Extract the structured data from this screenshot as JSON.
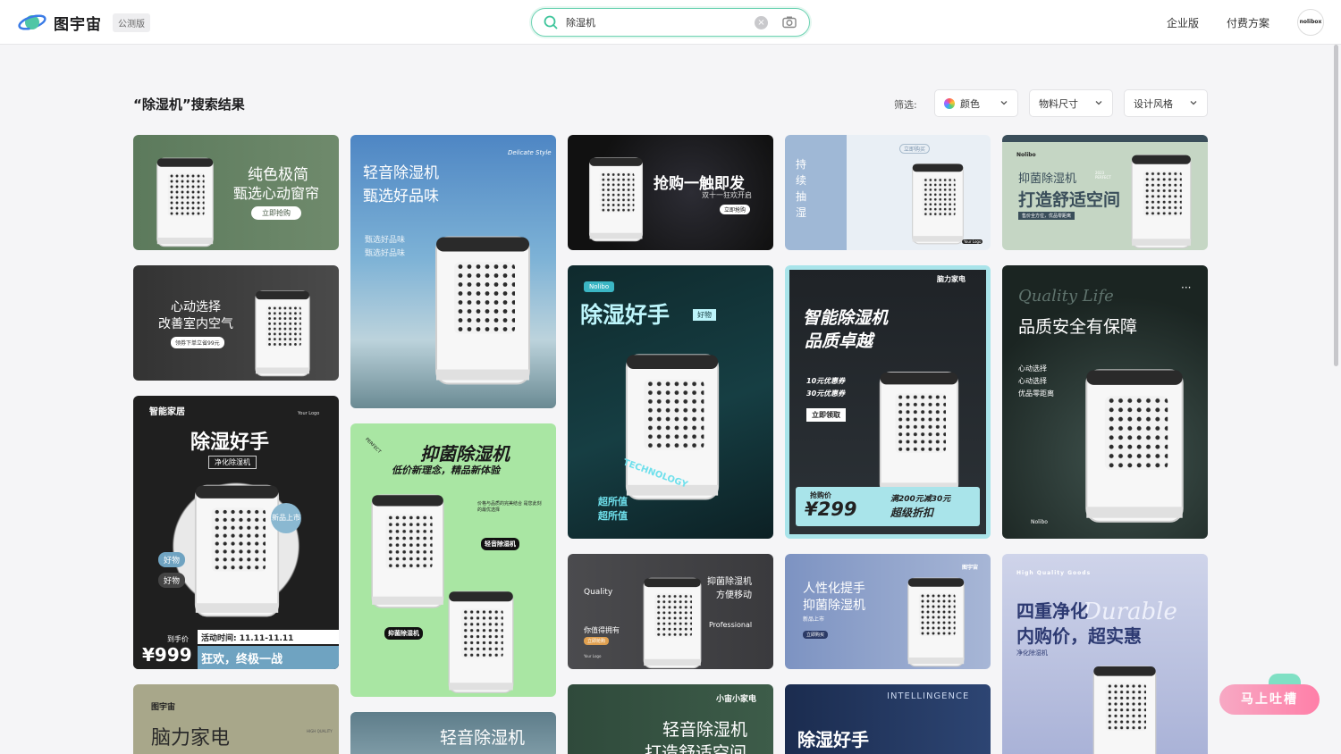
{
  "header": {
    "brand": "图宇宙",
    "beta_badge": "公测版",
    "search": {
      "value": "除湿机",
      "placeholder": ""
    },
    "nav": {
      "enterprise": "企业版",
      "pricing": "付费方案"
    },
    "avatar_text": "nolibox"
  },
  "results": {
    "title": "“除湿机”搜索结果",
    "filter_label": "筛选:",
    "filters": [
      "颜色",
      "物料尺寸",
      "设计风格"
    ]
  },
  "cards": {
    "c1": {
      "title": "纯色极简",
      "subtitle": "甄选心动窗帘",
      "cta": "立即抢购"
    },
    "c2": {
      "title": "心动选择",
      "subtitle": "改善室内空气",
      "cta": "领券下单立省99元"
    },
    "c3": {
      "tag": "智能家居",
      "logo": "Your Logo",
      "title": "除湿好手",
      "subtitle": "净化除湿机",
      "badge_new": "新品上市",
      "pill1": "好物",
      "pill2": "好物",
      "price_label": "到手价",
      "price": "¥999",
      "event": "活动时间: 11.11-11.11",
      "slogan": "狂欢，终极一战"
    },
    "c4": {
      "title": "脑力家电",
      "brand": "图宇宙",
      "side": "HIGH QUALITY"
    },
    "c5": {
      "script": "Delicate Style",
      "title": "轻音除湿机",
      "subtitle": "甄选好品味",
      "desc1": "甄选好品味",
      "desc2": "甄选好品味"
    },
    "c6": {
      "title": "抑菌除湿机",
      "subtitle": "低价新理念，精品新体验",
      "desc": "价格与品质的完美结合 是您此刻的最优选择",
      "tag1": "轻音除湿机",
      "tag2": "抑菌除湿机",
      "stamp": "PERFECT"
    },
    "c7": {
      "title": "轻音除湿机"
    },
    "c8": {
      "title": "抢购一触即发",
      "subtitle": "双十一狂欢开启",
      "cta": "立即抢购"
    },
    "c9": {
      "brand": "Nolibo",
      "title": "除湿好手",
      "badge": "好物",
      "line1": "超所值",
      "line2": "超所值",
      "ribbon": "TECHNOLOGY"
    },
    "c10": {
      "title1": "抑菌除湿机",
      "title2": "方便移动",
      "quality": "Quality",
      "professional": "Professional",
      "desc": "你值得拥有",
      "tag": "立即抢购",
      "logo": "Your Logo"
    },
    "c11": {
      "shop": "小宙小家电",
      "title": "轻音除湿机",
      "subtitle": "打造舒适空间"
    },
    "c12": {
      "side_text": "持续抽湿",
      "side_small": "智能除湿机",
      "cta": "立即购买",
      "logo": "Your Logo"
    },
    "c13": {
      "shop": "脑力家电",
      "title": "智能除湿机",
      "subtitle": "品质卓越",
      "coupon1": "10元优惠券",
      "coupon2": "30元优惠券",
      "cta": "立即领取",
      "price_label": "抢购价",
      "price": "¥299",
      "deal": "满200元减30元",
      "deal2": "超级折扣"
    },
    "c14": {
      "title": "人性化提手",
      "subtitle": "抑菌除湿机",
      "small": "新品上市",
      "cta": "立即购买",
      "brand": "图宇宙"
    },
    "c15": {
      "title": "除湿好手",
      "script": "INTELLINGENCE"
    },
    "c16": {
      "brand": "Nolibo",
      "title": "抑菌除湿机",
      "subtitle": "打造舒适空间",
      "tag": "售价全方位，优品零距离",
      "year": "2023 PERFECT"
    },
    "c17": {
      "script": "Quality Life",
      "title": "品质安全有保障",
      "l1": "心动选择",
      "l2": "心动选择",
      "l3": "优品零距离",
      "brand": "Nolibo"
    },
    "c18": {
      "header": "High Quality Goods",
      "title": "四重净化",
      "subtitle": "内购价，超实惠",
      "small": "净化除湿机",
      "script": "Durable"
    }
  },
  "feedback": "马上吐槽",
  "colors": {
    "accent": "#3ec59b",
    "feedback": "#ff7fa8"
  }
}
